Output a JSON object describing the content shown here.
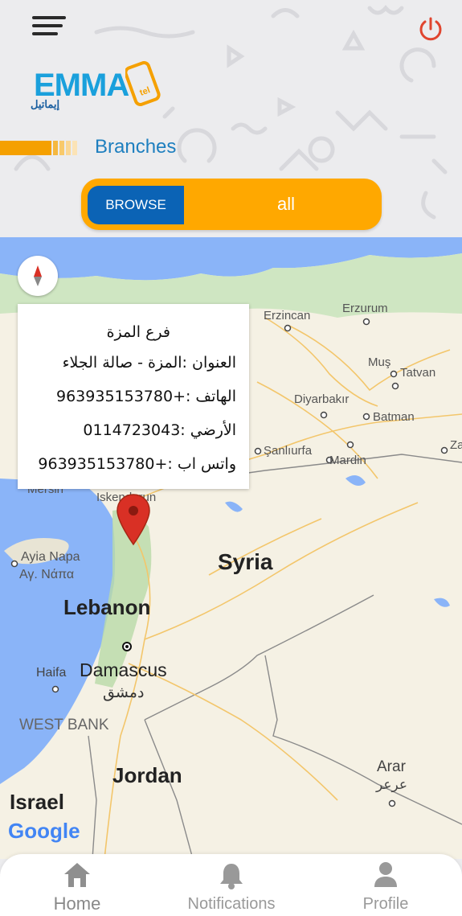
{
  "header": {
    "logo_word": "EMMA",
    "logo_suffix": "tel",
    "logo_arabic": "إيماتيل",
    "section_title": "Branches"
  },
  "toggle": {
    "browse_label": "BROWSE",
    "selected_value": "all"
  },
  "popup": {
    "title": "فرع المزة",
    "address": "العنوان :المزة - صالة الجلاء",
    "phone": "الهاتف :+963935153780",
    "landline": "الأرضي :0114723043",
    "whatsapp": "واتس اب :+963935153780"
  },
  "map": {
    "cities": {
      "erzincan": "Erzincan",
      "erzurum": "Erzurum",
      "mus": "Muş",
      "tatvan": "Tatvan",
      "diyarbakir": "Diyarbakır",
      "batman": "Batman",
      "sanliurfa": "Şanlıurfa",
      "mardin": "Mardin",
      "za": "Za",
      "iskenderun": "Iskenderun",
      "mersin": "Mersin",
      "ayia_napa": "Ayia Napa",
      "ayia_napa_gr": "Αγ. Νάπα",
      "haifa": "Haifa",
      "damascus": "Damascus",
      "damascus_ar": "دمشق",
      "arar": "Arar",
      "arar_ar": "عرعر",
      "west_bank": "WEST BANK"
    },
    "countries": {
      "syria": "Syria",
      "lebanon": "Lebanon",
      "jordan": "Jordan",
      "israel": "Israel"
    },
    "attribution": "Google"
  },
  "tabs": [
    {
      "label": "Home",
      "icon": "home-icon"
    },
    {
      "label": "Notifications",
      "icon": "bell-icon"
    },
    {
      "label": "Profile",
      "icon": "person-icon"
    }
  ],
  "colors": {
    "accent_orange": "#ffa800",
    "brand_blue": "#0b63b5",
    "title_blue": "#1e7fbf",
    "power_red": "#e0452f",
    "marker_red": "#d93025"
  }
}
